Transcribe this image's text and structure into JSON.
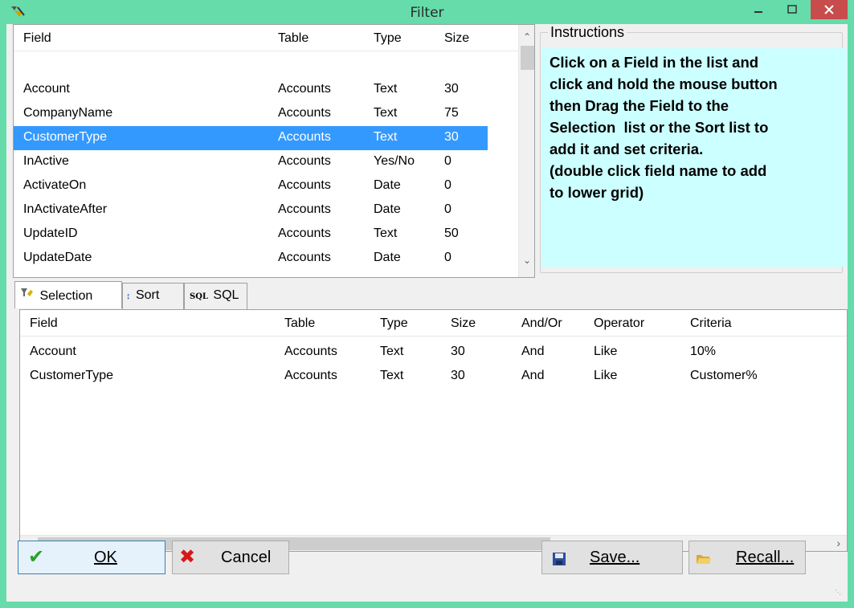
{
  "window": {
    "title": "Filter"
  },
  "field_list": {
    "columns": [
      "Field",
      "Table",
      "Type",
      "Size"
    ],
    "rows": [
      [
        "Account",
        "Accounts",
        "Text",
        "30"
      ],
      [
        "CompanyName",
        "Accounts",
        "Text",
        "75"
      ],
      [
        "CustomerType",
        "Accounts",
        "Text",
        "30"
      ],
      [
        "InActive",
        "Accounts",
        "Yes/No",
        "0"
      ],
      [
        "ActivateOn",
        "Accounts",
        "Date",
        "0"
      ],
      [
        "InActivateAfter",
        "Accounts",
        "Date",
        "0"
      ],
      [
        "UpdateID",
        "Accounts",
        "Text",
        "50"
      ],
      [
        "UpdateDate",
        "Accounts",
        "Date",
        "0"
      ]
    ],
    "selected_row": 2
  },
  "instructions": {
    "label": "Instructions",
    "lines": [
      "Click on a Field in the list and",
      "click and hold the mouse button",
      "then Drag the Field to the",
      "Selection  list or the Sort list to",
      "add it and set criteria.",
      "(double click field name to add",
      "to lower grid)"
    ]
  },
  "tabs": [
    {
      "label": "Selection",
      "icon": "filter-icon"
    },
    {
      "label": "Sort",
      "icon": "sort-az-icon"
    },
    {
      "label": "SQL",
      "icon": "sql-icon"
    }
  ],
  "selection_grid": {
    "columns": [
      "Field",
      "Table",
      "Type",
      "Size",
      "And/Or",
      "Operator",
      "Criteria"
    ],
    "rows": [
      [
        "Account",
        "Accounts",
        "Text",
        "30",
        "And",
        "Like",
        "10%"
      ],
      [
        "CustomerType",
        "Accounts",
        "Text",
        "30",
        "And",
        "Like",
        "Customer%"
      ]
    ]
  },
  "buttons": {
    "ok": "OK",
    "cancel": "Cancel",
    "save": "Save...",
    "recall": "Recall..."
  },
  "colors": {
    "titlebar": "#65dcaa",
    "selection": "#3399ff",
    "instructions_bg": "#ccffff",
    "close_button": "#c94c4c"
  }
}
